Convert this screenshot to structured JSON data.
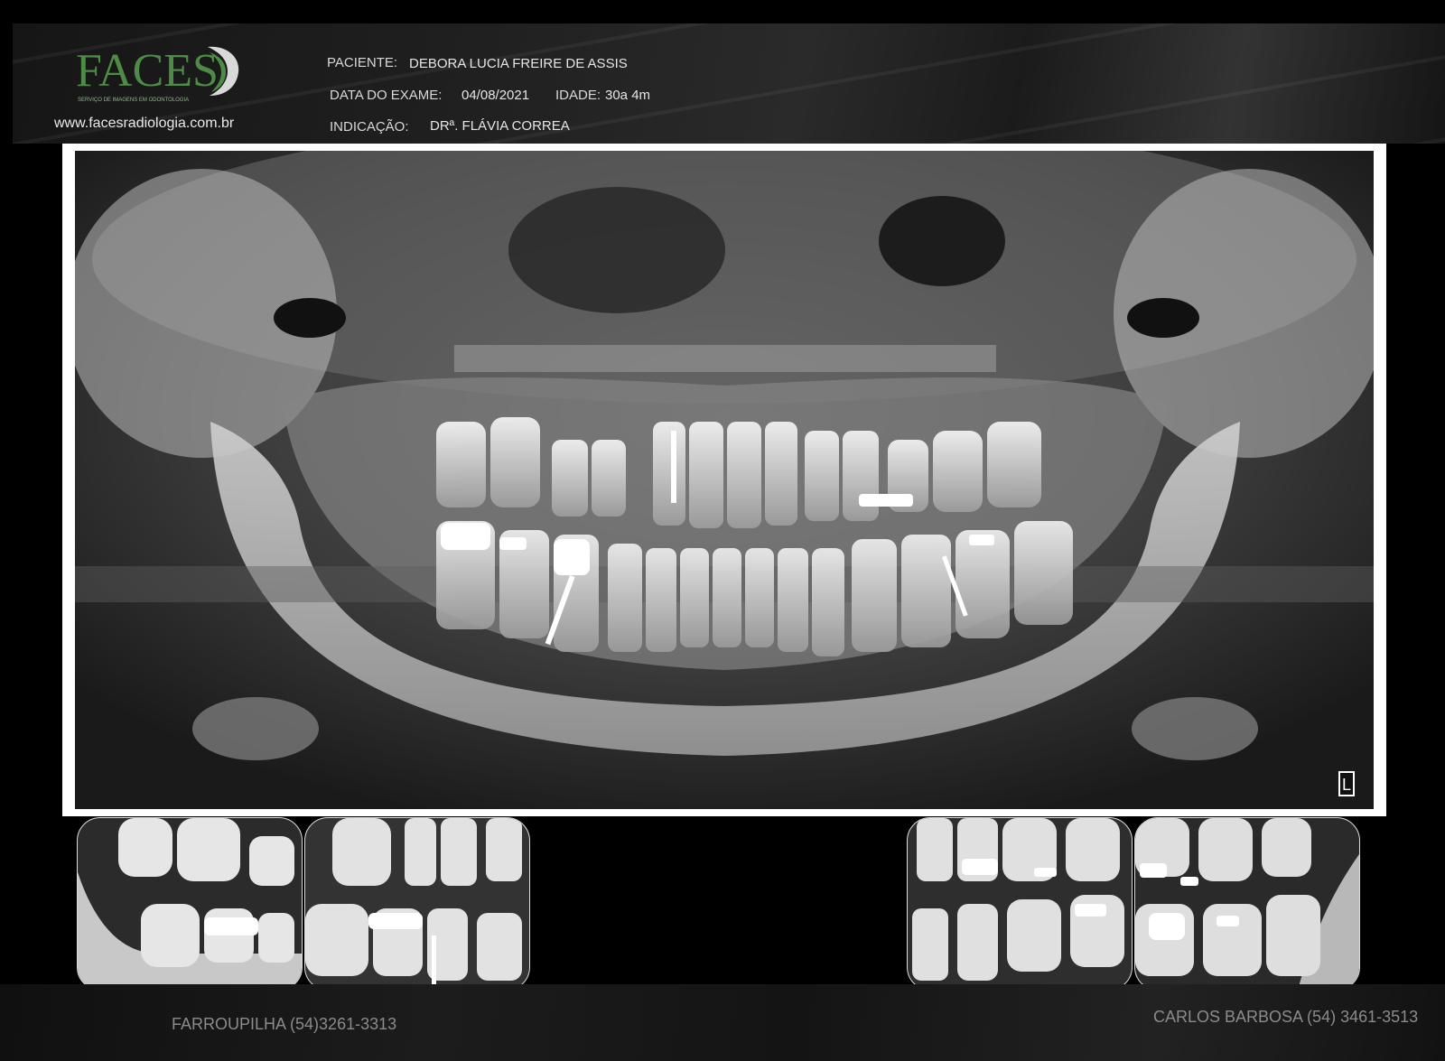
{
  "brand": {
    "logo_text": "FACES",
    "tagline": "SERVIÇO DE IMAGENS EM ODONTOLOGIA",
    "website": "www.facesradiologia.com.br",
    "accent_color": "#4e8b47"
  },
  "patient": {
    "name_label": "PACIENTE:",
    "name_value": "DEBORA LUCIA FREIRE DE ASSIS",
    "date_label": "DATA DO EXAME:",
    "date_value": "04/08/2021",
    "age_label": "IDADE:",
    "age_value": "30a 4m",
    "indication_label": "INDICAÇÃO:",
    "indication_value": "DRª. FLÁVIA CORREA"
  },
  "radiograph": {
    "side_marker": "L"
  },
  "bitewings": {
    "count": 4
  },
  "footer": {
    "left_contact": "FARROUPILHA (54)3261-3313",
    "right_contact": "CARLOS BARBOSA (54) 3461-3513"
  }
}
